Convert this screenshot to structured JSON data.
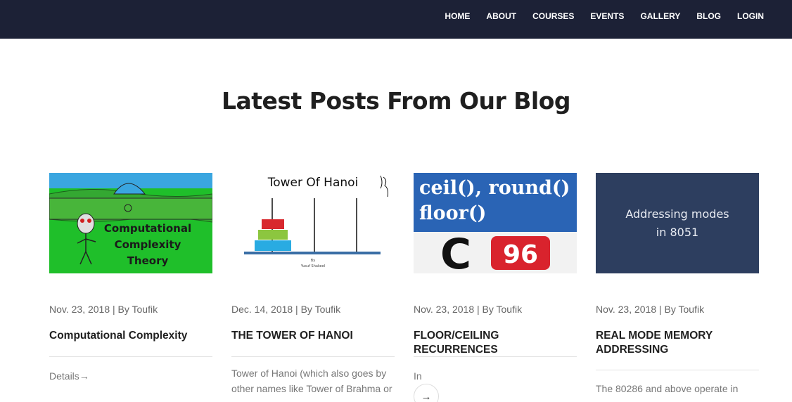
{
  "nav": {
    "items": [
      "HOME",
      "ABOUT",
      "COURSES",
      "EVENTS",
      "GALLERY",
      "BLOG",
      "LOGIN"
    ]
  },
  "section": {
    "title": "Latest Posts From Our Blog"
  },
  "posts": [
    {
      "thumb_text": [
        "Computational",
        "Complexity",
        "Theory"
      ],
      "meta": "Nov. 23, 2018 | By Toufik",
      "title": "Computational Complexity",
      "link": "Details→"
    },
    {
      "thumb_text": [
        "Tower Of Hanoi",
        "By",
        "Yusuf Shakeel"
      ],
      "meta": "Dec. 14, 2018 | By Toufik",
      "title": "THE TOWER OF HANOI",
      "excerpt": "Tower of Hanoi (which also goes by other names like Tower of Brahma or"
    },
    {
      "thumb_text": [
        "ceil(), round()",
        "floor()",
        "C",
        "96"
      ],
      "meta": "Nov. 23, 2018 | By Toufik",
      "title": "FLOOR/CEILING RECURRENCES",
      "excerpt": "In",
      "arrow": "→"
    },
    {
      "thumb_text": [
        "Addressing modes",
        "in 8051"
      ],
      "meta": "Nov. 23, 2018 | By Toufik",
      "title": "REAL MODE MEMORY ADDRESSING",
      "excerpt": "The 80286 and above operate in"
    }
  ],
  "colors": {
    "topbar": "#1c2136",
    "card4_bg": "#2d3e5f",
    "green_thumb": "#1f9a2f"
  }
}
